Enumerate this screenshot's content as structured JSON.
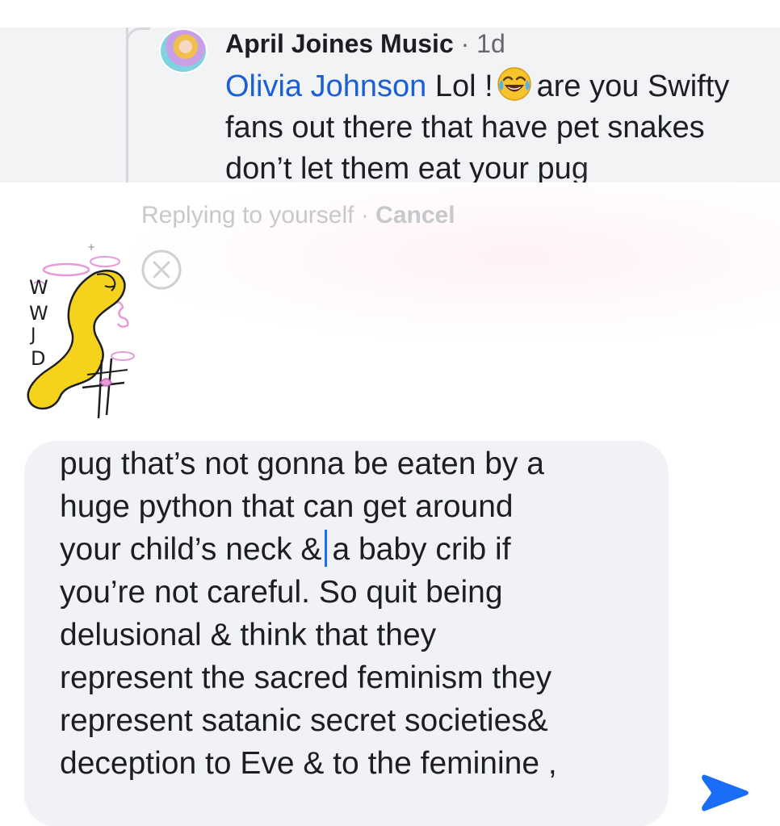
{
  "comment": {
    "author": "April Joines Music",
    "separator": "·",
    "time": "1d",
    "mention": "Olivia Johnson",
    "text_part1": "Lol !",
    "emoji_icon": "face-with-tears-of-joy-icon",
    "text_part2": "are you Swifty fans out there that have pet snakes don’t let them eat your pug"
  },
  "reply_bar": {
    "replying_label": "Replying to yourself",
    "separator": "·",
    "cancel_label": "Cancel"
  },
  "doodle": {
    "letters": [
      "W",
      "W",
      "J",
      "D"
    ]
  },
  "composer": {
    "text_before_caret": "pug that’s not gonna be eaten by a\nhuge python that can get around\nyour child’s neck &",
    "text_after_caret": "a baby crib if\nyou’re not careful. So quit being\ndelusional &  think that they\nrepresent the sacred feminism they\nrepresent satanic secret societies&\ndeception to Eve & to the feminine ,"
  },
  "colors": {
    "accent_blue": "#1a6ef5",
    "mention_blue": "#1a5fd6",
    "doodle_yellow": "#f5d21c",
    "doodle_pink": "#e89ad8"
  }
}
